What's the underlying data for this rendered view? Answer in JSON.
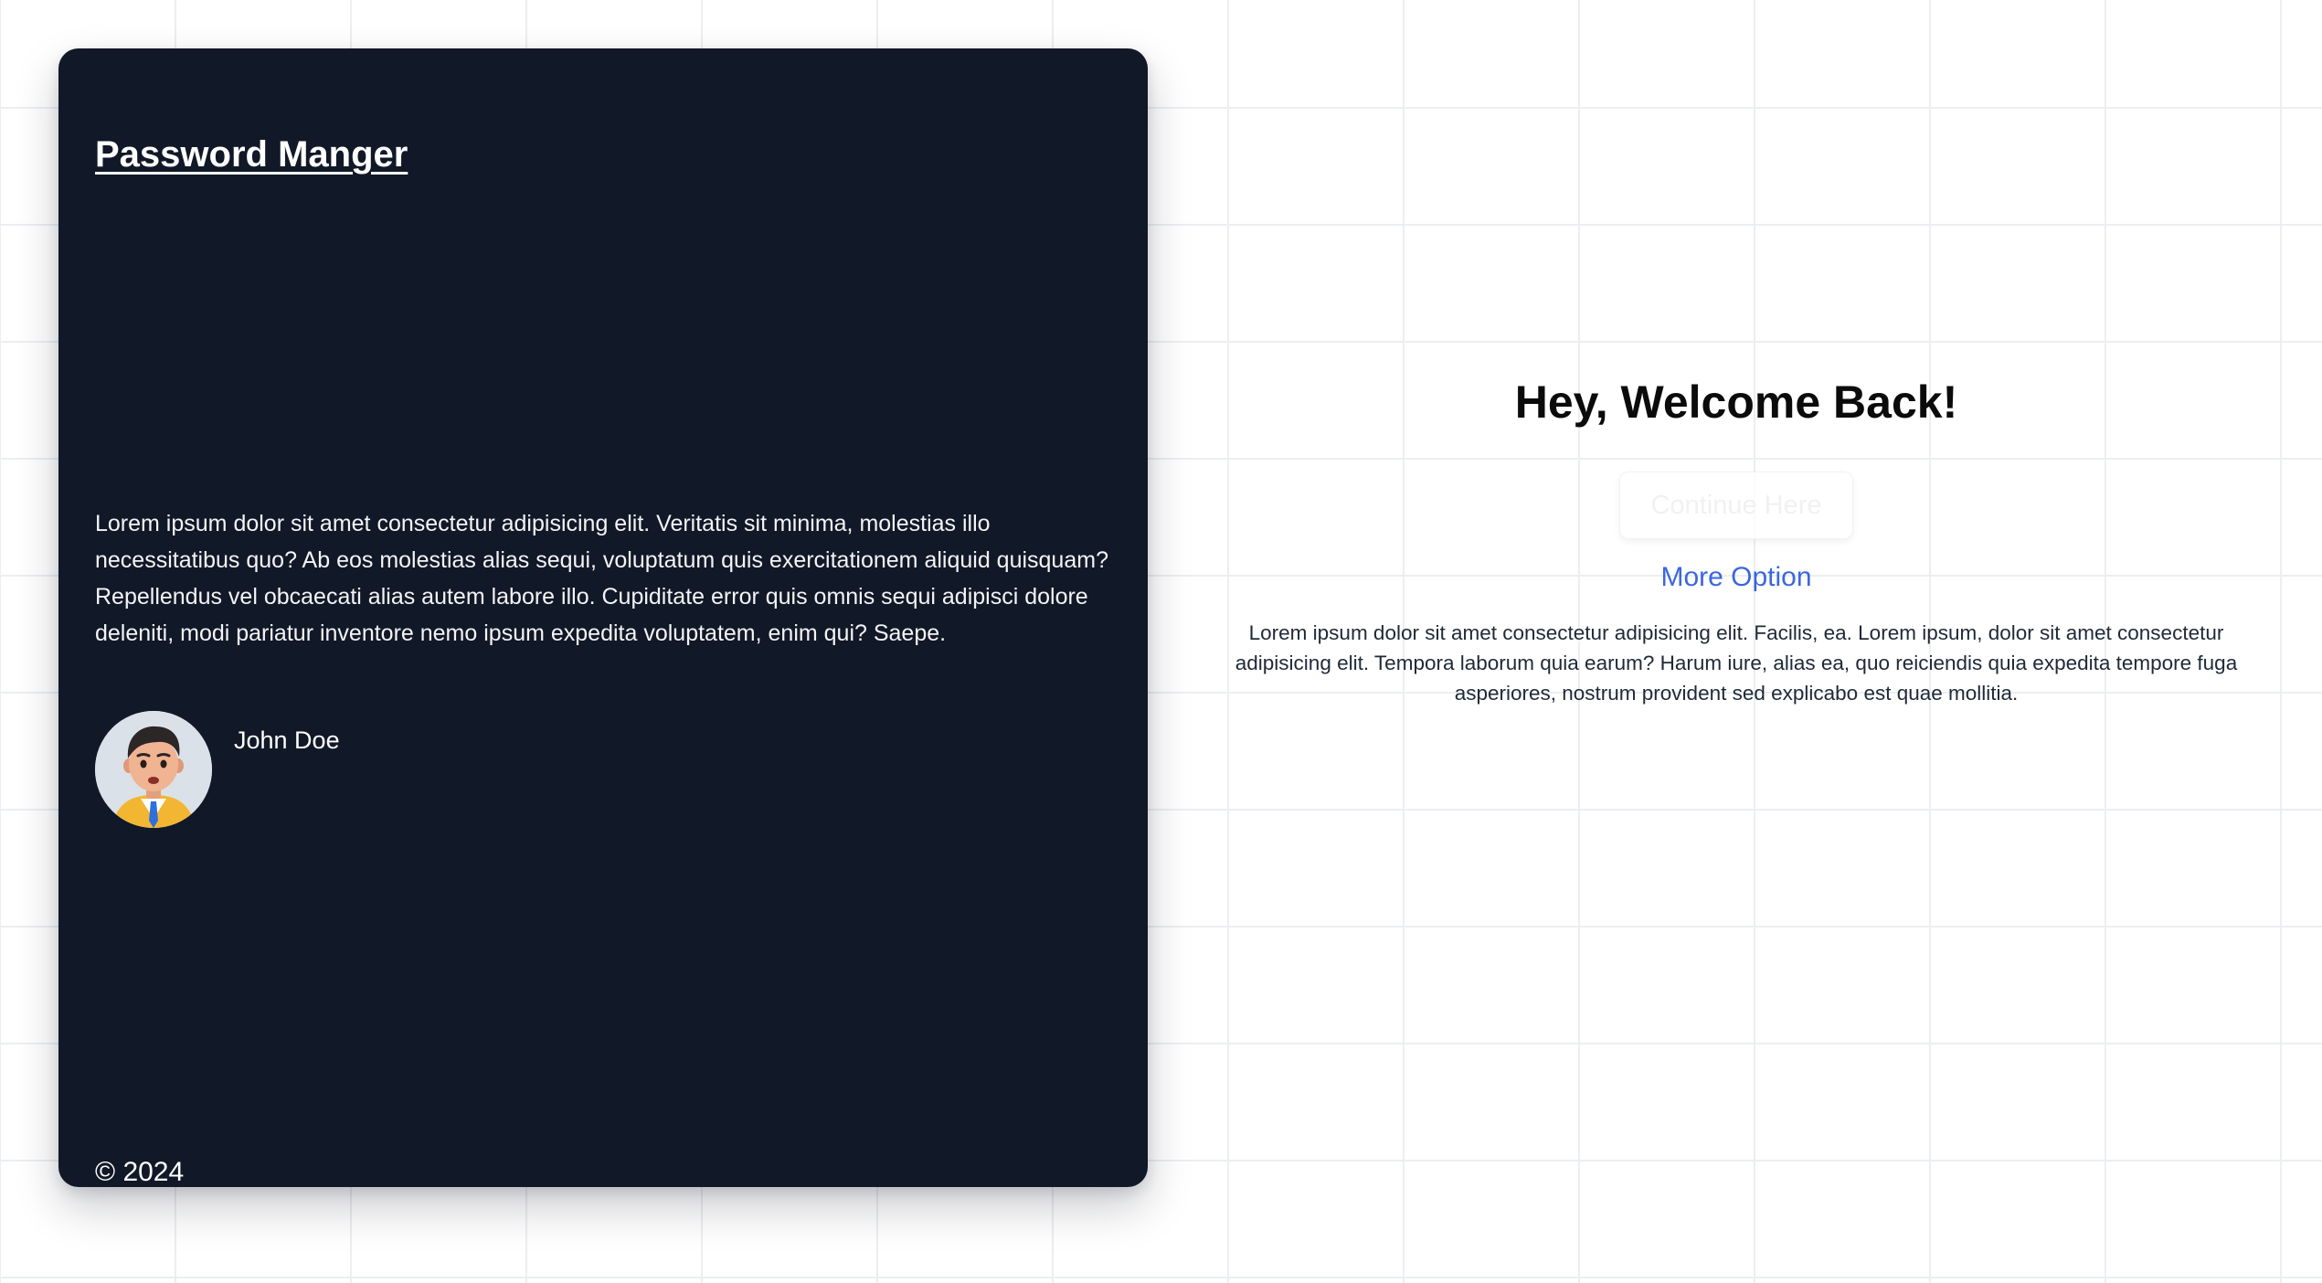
{
  "brand": {
    "title": "Password Manger"
  },
  "testimonial": {
    "text": "Lorem ipsum dolor sit amet consectetur adipisicing elit. Veritatis sit minima, molestias illo necessitatibus quo? Ab eos molestias alias sequi, voluptatum quis exercitationem aliquid quisquam? Repellendus vel obcaecati alias autem labore illo. Cupiditate error quis omnis sequi adipisci dolore deleniti, modi pariatur inventore nemo ipsum expedita voluptatem, enim qui? Saepe.",
    "author_name": "John Doe",
    "avatar_icon": "avatar-3d-man"
  },
  "footer": {
    "copyright": "© 2024"
  },
  "welcome": {
    "title": "Hey, Welcome Back!",
    "continue_label": "Continue Here",
    "more_option_label": "More Option",
    "description": "Lorem ipsum dolor sit amet consectetur adipisicing elit. Facilis, ea. Lorem ipsum, dolor sit amet consectetur adipisicing elit. Tempora laborum quia earum? Harum iure, alias ea, quo reiciendis quia expedita tempore fuga asperiores, nostrum provident sed explicabo est quae mollitia."
  },
  "colors": {
    "panel_background": "#111827",
    "link": "#3b66e0",
    "page_background": "#ffffff",
    "grid_line": "#eceef1"
  }
}
